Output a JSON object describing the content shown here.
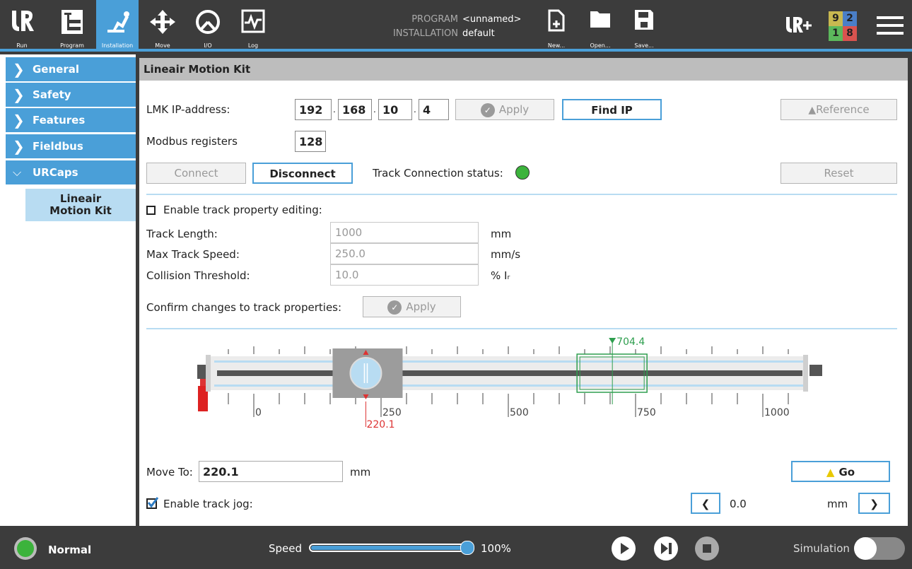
{
  "topbar": {
    "nav": [
      {
        "label": "Run",
        "icon": "ur-logo-icon"
      },
      {
        "label": "Program",
        "icon": "program-icon"
      },
      {
        "label": "Installation",
        "icon": "robot-arm-icon"
      },
      {
        "label": "Move",
        "icon": "move-arrows-icon"
      },
      {
        "label": "I/O",
        "icon": "io-gauge-icon"
      },
      {
        "label": "Log",
        "icon": "log-chart-icon"
      }
    ],
    "program_label": "PROGRAM",
    "program_value": "<unnamed>",
    "installation_label": "INSTALLATION",
    "installation_value": "default",
    "file_actions": [
      {
        "label": "New...",
        "icon": "new-file-icon"
      },
      {
        "label": "Open...",
        "icon": "folder-icon"
      },
      {
        "label": "Save...",
        "icon": "save-icon"
      }
    ],
    "urplus_icon": "ur-plus-icon",
    "counters": [
      {
        "value": "9",
        "color": "#c8b850"
      },
      {
        "value": "2",
        "color": "#4a7fc8"
      },
      {
        "value": "1",
        "color": "#5cb85c"
      },
      {
        "value": "8",
        "color": "#d9534f"
      }
    ],
    "menu_icon": "hamburger-menu-icon"
  },
  "sidebar": {
    "items": [
      {
        "label": "General",
        "expanded": false
      },
      {
        "label": "Safety",
        "expanded": false
      },
      {
        "label": "Features",
        "expanded": false
      },
      {
        "label": "Fieldbus",
        "expanded": false
      },
      {
        "label": "URCaps",
        "expanded": true
      }
    ],
    "subitem_line1": "Lineair",
    "subitem_line2": "Motion Kit"
  },
  "main": {
    "title": "Lineair Motion Kit",
    "ip_label": "LMK IP-address:",
    "ip": [
      "192",
      "168",
      "10",
      "4"
    ],
    "ip_sep": ".",
    "apply_label": "Apply",
    "find_ip_label": "Find IP",
    "reference_label": "Reference",
    "modbus_label": "Modbus registers",
    "modbus_value": "128",
    "connect_label": "Connect",
    "disconnect_label": "Disconnect",
    "status_label": "Track Connection status:",
    "status_color": "#3cb33c",
    "reset_label": "Reset",
    "enable_edit_label": "Enable track property editing:",
    "enable_edit_checked": false,
    "props": [
      {
        "label": "Track Length:",
        "value": "1000",
        "unit": "mm"
      },
      {
        "label": "Max Track Speed:",
        "value": "250.0",
        "unit": "mm/s"
      },
      {
        "label": "Collision Threshold:",
        "value": "10.0",
        "unit": "% Iᵣ"
      }
    ],
    "confirm_label": "Confirm changes to track properties:",
    "confirm_apply_label": "Apply",
    "track": {
      "length": 1000,
      "ticks": [
        "0",
        "250",
        "500",
        "750",
        "1000"
      ],
      "current_position": 220.1,
      "current_label": "220.1",
      "target_position": 704.4,
      "target_label": "704.4"
    },
    "move_to_label": "Move To:",
    "move_to_value": "220.1",
    "move_to_unit": "mm",
    "go_label": "Go",
    "jog_label": "Enable track jog:",
    "jog_checked": true,
    "jog_value": "0.0",
    "jog_unit": "mm"
  },
  "bottombar": {
    "status": "Normal",
    "status_color": "#3cb33c",
    "speed_label": "Speed",
    "speed_percent": 100,
    "speed_text": "100%",
    "simulation_label": "Simulation",
    "simulation_on": false
  }
}
